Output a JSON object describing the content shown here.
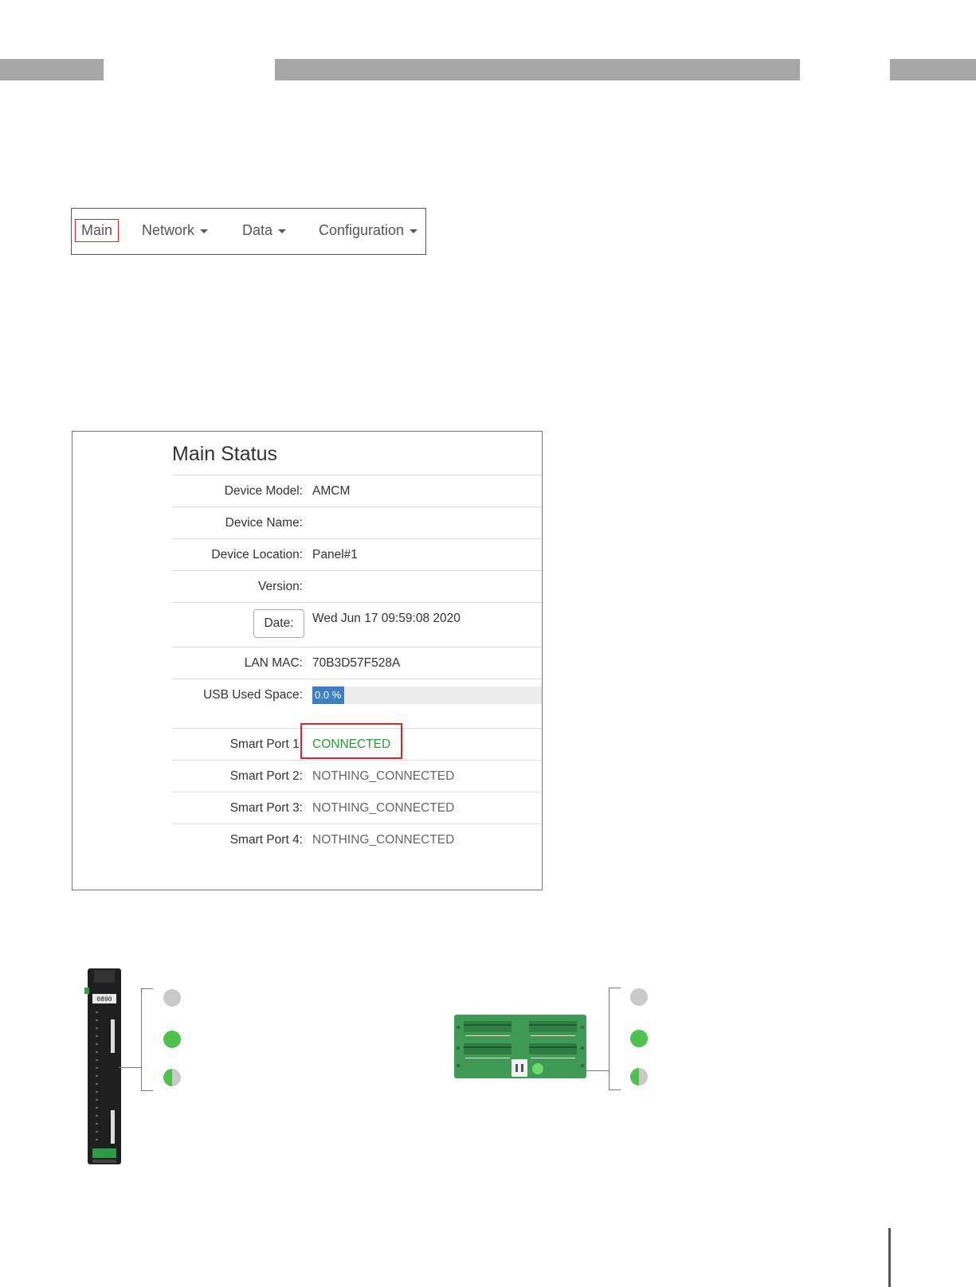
{
  "nav": {
    "items": [
      {
        "label": "Main",
        "selected": true
      },
      {
        "label": "Network",
        "dropdown": true
      },
      {
        "label": "Data",
        "dropdown": true
      },
      {
        "label": "Configuration",
        "dropdown": true
      }
    ]
  },
  "status": {
    "title": "Main Status",
    "device_model_label": "Device Model:",
    "device_model_value": "AMCM",
    "device_name_label": "Device Name:",
    "device_name_value": "",
    "device_location_label": "Device Location:",
    "device_location_value": "Panel#1",
    "version_label": "Version:",
    "version_value": "",
    "date_button_label": "Date:",
    "date_value": "Wed Jun 17 09:59:08 2020",
    "lan_mac_label": "LAN MAC:",
    "lan_mac_value": "70B3D57F528A",
    "usb_label": "USB Used Space:",
    "usb_value_text": "0.0 %",
    "usb_used_percent": 0.0,
    "smart_ports": [
      {
        "label": "Smart Port 1:",
        "value": "CONNECTED",
        "highlighted": true
      },
      {
        "label": "Smart Port 2:",
        "value": "NOTHING_CONNECTED"
      },
      {
        "label": "Smart Port 3:",
        "value": "NOTHING_CONNECTED"
      },
      {
        "label": "Smart Port 4:",
        "value": "NOTHING_CONNECTED"
      }
    ]
  },
  "colors": {
    "highlight_red": "#d8262d",
    "connected_green": "#2a9a37",
    "progress_blue": "#3c7fc3",
    "led_green": "#4cc14c",
    "led_grey": "#c9c9c9"
  },
  "illustrations": {
    "left_device": {
      "leds": [
        "off",
        "on",
        "blinking"
      ]
    },
    "right_device": {
      "leds": [
        "off",
        "on",
        "blinking"
      ]
    }
  }
}
